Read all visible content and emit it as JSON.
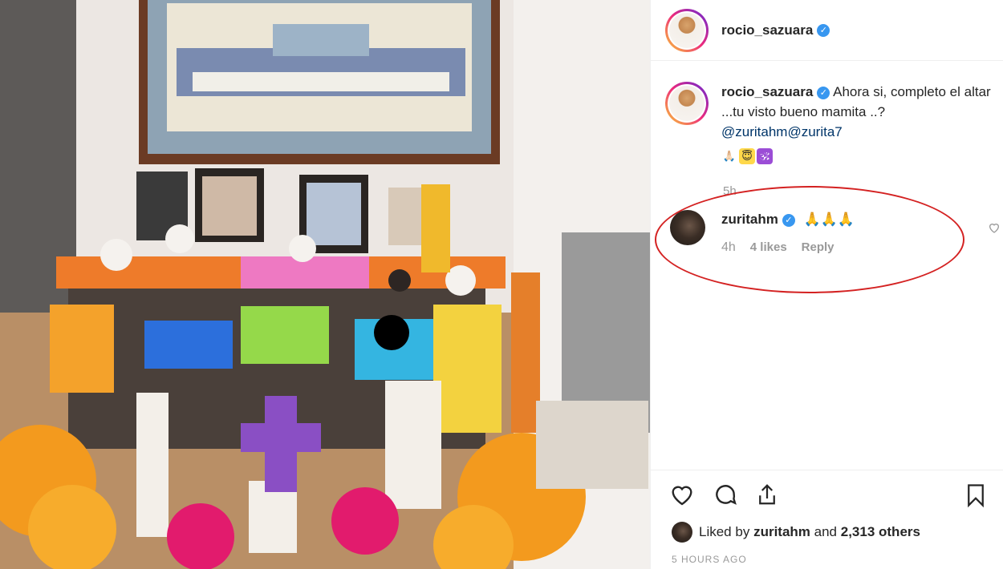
{
  "post": {
    "username": "rocio_sazuara",
    "verified_glyph": "✓",
    "caption_text_1": "Ahora si, completo el altar ...tu visto bueno mamita ..?",
    "caption_mention_1": "@zuritahm",
    "caption_mention_2": "@zurita7",
    "caption_time": "5h",
    "caption_emojis": [
      "🙏🏻",
      "😇",
      "🕉"
    ]
  },
  "comment": {
    "username": "zuritahm",
    "text": "🙏🙏🙏",
    "time": "4h",
    "likes": "4 likes",
    "reply": "Reply"
  },
  "footer": {
    "liked_by_prefix": "Liked by",
    "liked_by_user": "zuritahm",
    "liked_and": "and",
    "liked_others": "2,313 others",
    "timestamp": "5 HOURS AGO"
  },
  "colors": {
    "accent_blue": "#3897f0",
    "highlight_ellipse": "#d42222",
    "mention": "#003569"
  }
}
